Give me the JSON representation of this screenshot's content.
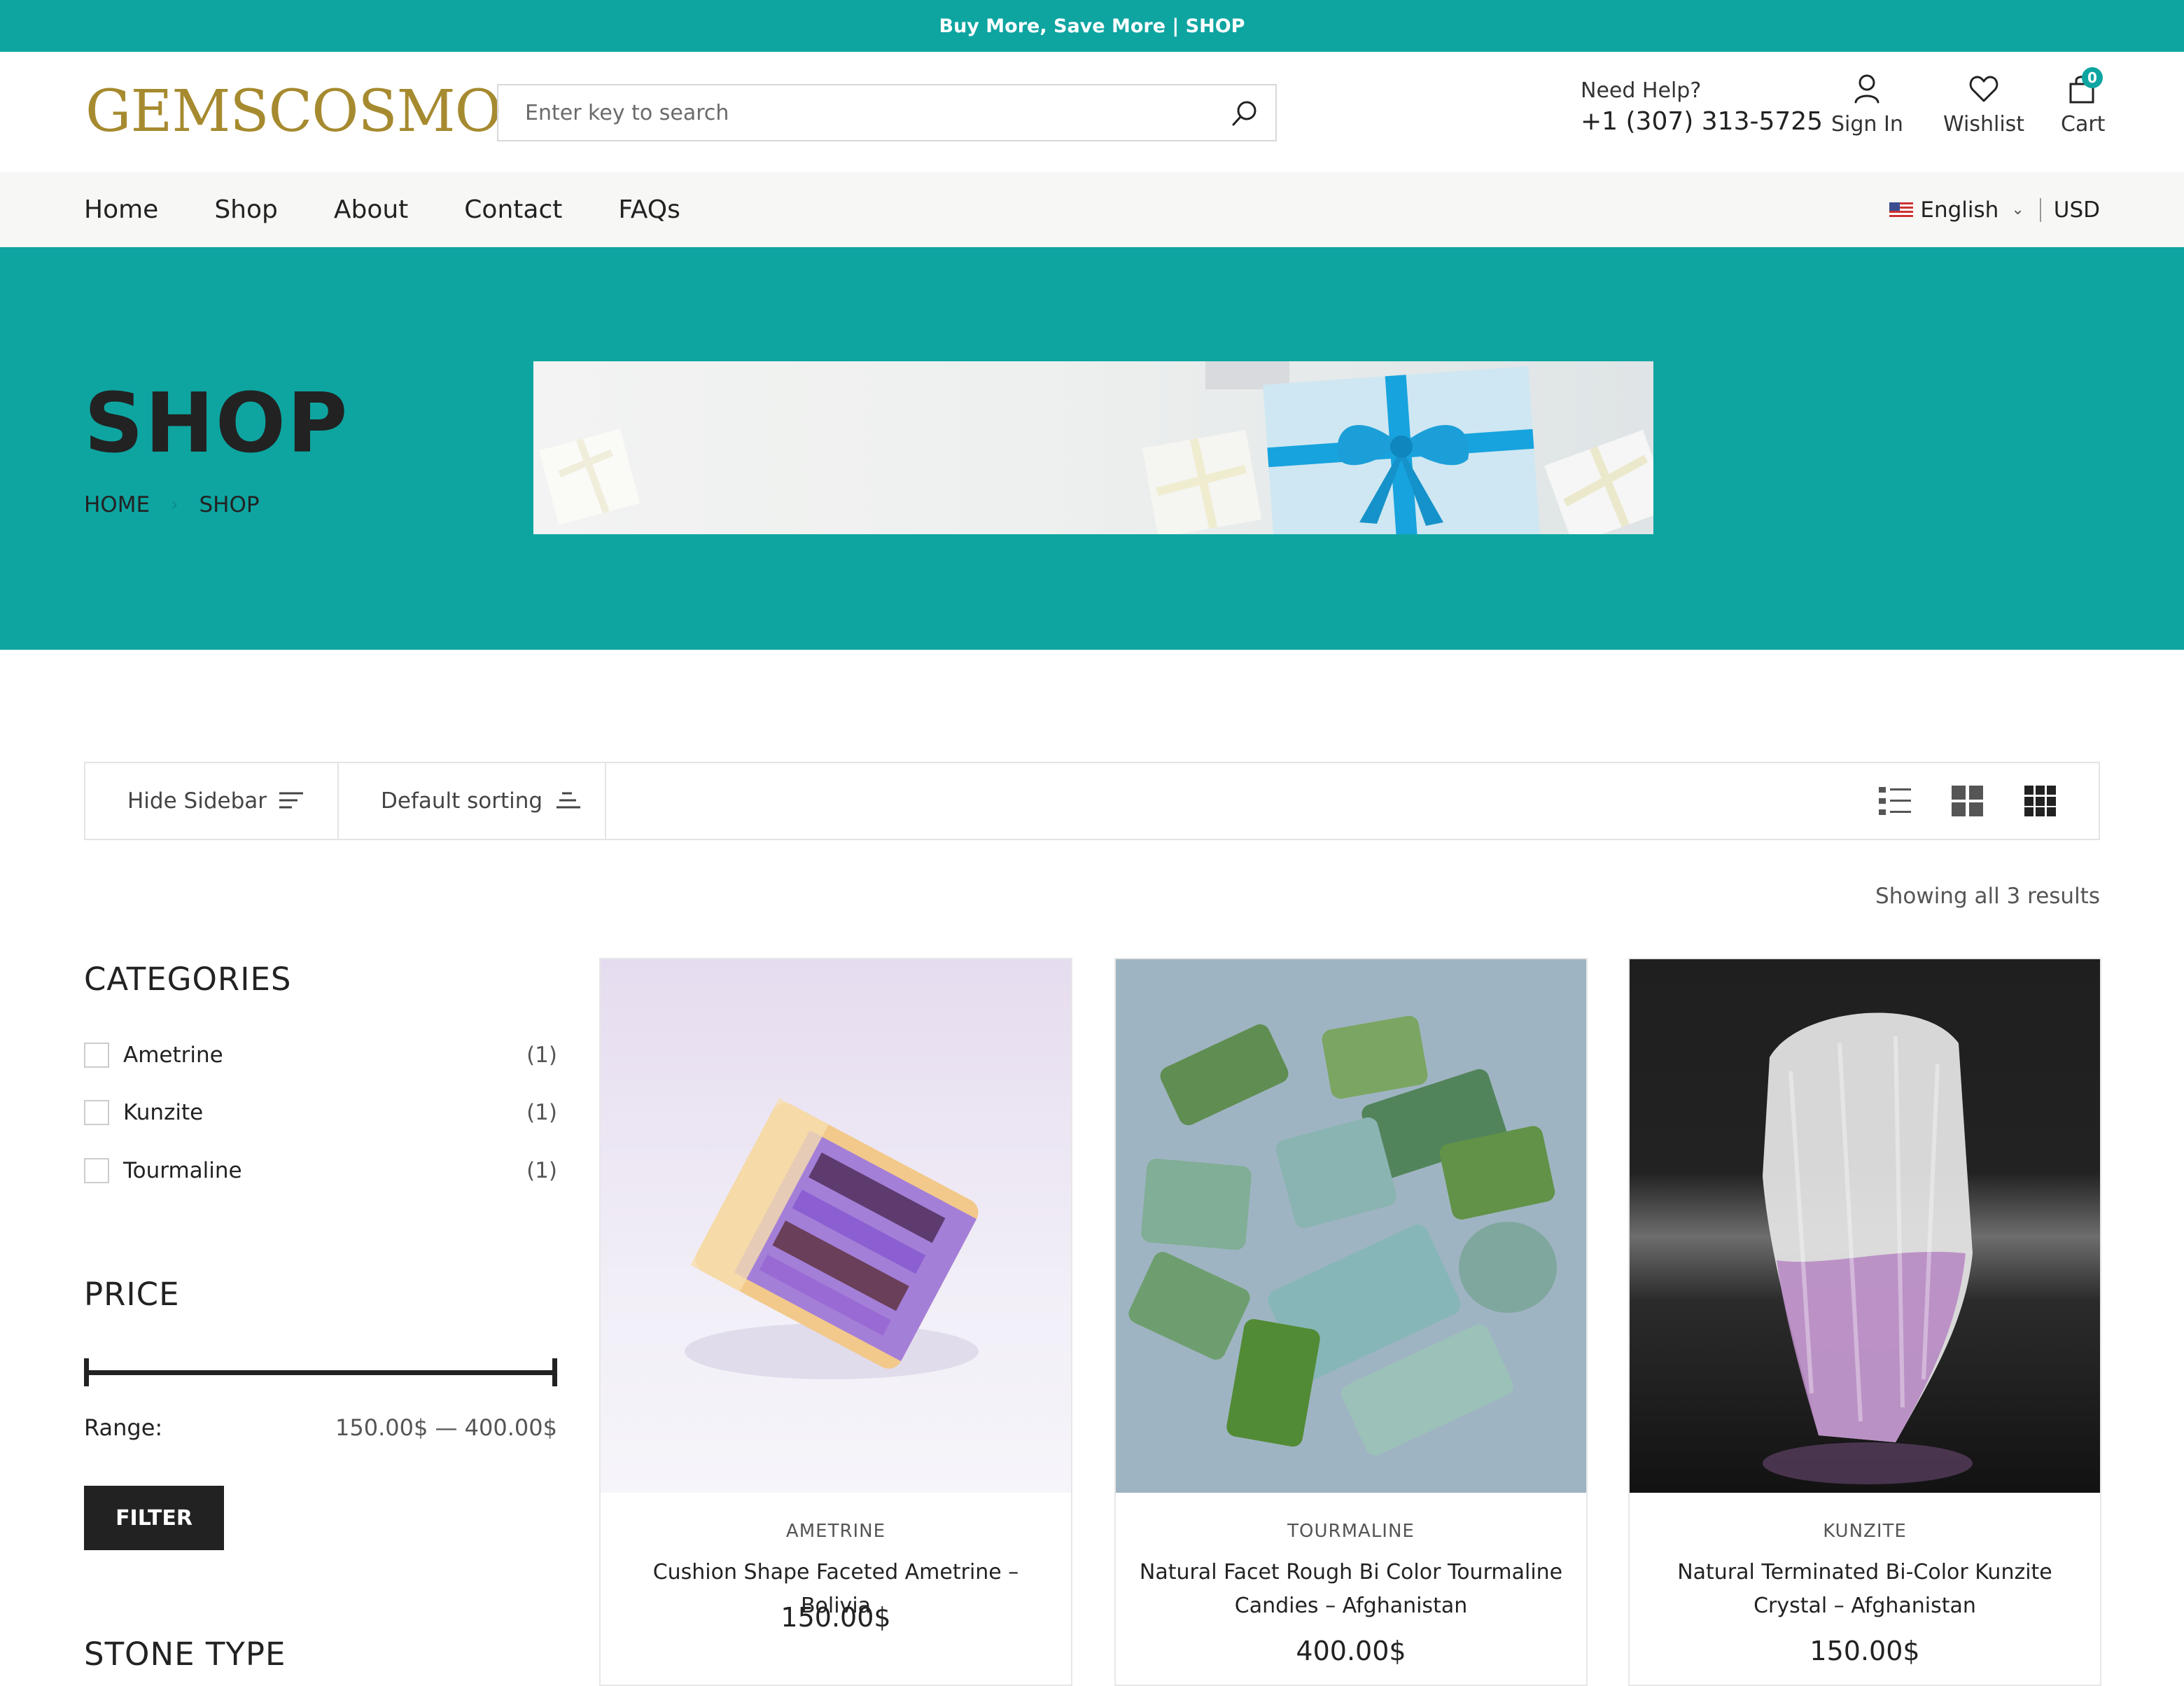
{
  "promo": {
    "text": "Buy More, Save More | SHOP"
  },
  "header": {
    "logo": "GEMSCOSMO",
    "search_placeholder": "Enter key to search",
    "help_label": "Need Help?",
    "phone": "+1 (307) 313-5725",
    "sign_in": "Sign In",
    "wishlist": "Wishlist",
    "cart": "Cart",
    "cart_count": "0"
  },
  "nav": {
    "items": [
      {
        "label": "Home"
      },
      {
        "label": "Shop"
      },
      {
        "label": "About"
      },
      {
        "label": "Contact"
      },
      {
        "label": "FAQs"
      }
    ],
    "language": "English",
    "currency": "USD"
  },
  "hero": {
    "title": "SHOP",
    "breadcrumb": [
      "HOME",
      "SHOP"
    ]
  },
  "toolbar": {
    "hide_sidebar": "Hide Sidebar",
    "sorting": "Default sorting",
    "views": [
      "list-view-icon",
      "grid-2-icon",
      "grid-3-icon"
    ]
  },
  "results_text": "Showing all 3 results",
  "sidebar": {
    "categories_title": "CATEGORIES",
    "categories": [
      {
        "label": "Ametrine",
        "count": "(1)"
      },
      {
        "label": "Kunzite",
        "count": "(1)"
      },
      {
        "label": "Tourmaline",
        "count": "(1)"
      }
    ],
    "price_title": "PRICE",
    "range_label": "Range:",
    "range_values": "150.00$ — 400.00$",
    "filter_button": "FILTER",
    "stone_type_title": "STONE TYPE"
  },
  "products": [
    {
      "category": "AMETRINE",
      "title": "Cushion Shape Faceted Ametrine – Bolivia",
      "price": "150.00$"
    },
    {
      "category": "TOURMALINE",
      "title": "Natural Facet Rough Bi Color Tourmaline Candies – Afghanistan",
      "price": "400.00$"
    },
    {
      "category": "KUNZITE",
      "title": "Natural Terminated Bi-Color Kunzite Crystal – Afghanistan",
      "price": "150.00$"
    }
  ],
  "colors": {
    "accent": "#0ea5a1",
    "logo": "#a68a2f",
    "dark": "#222222"
  }
}
